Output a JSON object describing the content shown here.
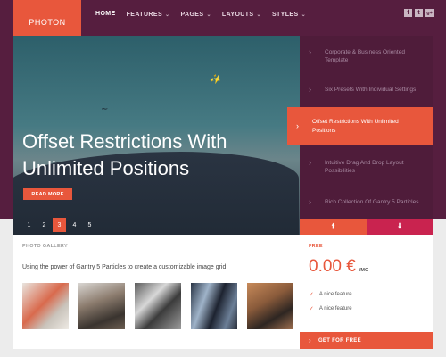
{
  "header": {
    "logo": "PHOTON",
    "nav": [
      {
        "label": "HOME",
        "active": true,
        "dropdown": false
      },
      {
        "label": "FEATURES",
        "active": false,
        "dropdown": true
      },
      {
        "label": "PAGES",
        "active": false,
        "dropdown": true
      },
      {
        "label": "LAYOUTS",
        "active": false,
        "dropdown": true
      },
      {
        "label": "STYLES",
        "active": false,
        "dropdown": true
      }
    ],
    "socials": [
      {
        "icon": "facebook-icon",
        "glyph": "f"
      },
      {
        "icon": "twitter-icon",
        "glyph": "t"
      },
      {
        "icon": "google-plus-icon",
        "glyph": "g+"
      }
    ]
  },
  "hero": {
    "title": "Offset Restrictions With\nUnlimited Positions",
    "button": "READ MORE",
    "pages": [
      "1",
      "2",
      "3",
      "4",
      "5"
    ],
    "active_page": "3"
  },
  "features": [
    {
      "text": "Corporate & Business Oriented Template"
    },
    {
      "text": "Six Presets With Individual Settings"
    },
    {
      "text": "Offset Restrictions With Unlimited Positions",
      "active": true
    },
    {
      "text": "Intuitive Drag And Drop Layout Possibilities"
    },
    {
      "text": "Rich Collection Of Gantry 5 Particles"
    }
  ],
  "gallery": {
    "label": "PHOTO GALLERY",
    "text": "Using the power of Gantry 5 Particles to create a customizable image grid."
  },
  "pricing": {
    "label": "FREE",
    "price": "0.00 €",
    "period": "/MO",
    "perks": [
      "A nice feature",
      "A nice feature"
    ],
    "cta": "GET FOR FREE"
  },
  "colors": {
    "accent": "#e8573c",
    "header_bg": "#561e3f",
    "pink": "#c9234f"
  }
}
